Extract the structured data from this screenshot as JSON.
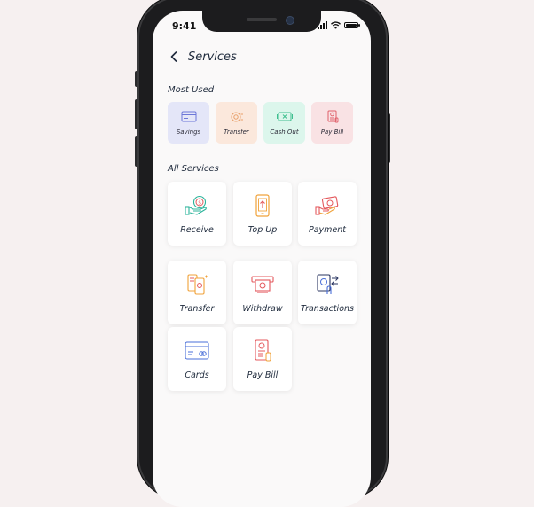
{
  "status_bar": {
    "time": "9:41"
  },
  "header": {
    "title": "Services"
  },
  "sections": {
    "most_used": "Most Used",
    "all_services": "All Services"
  },
  "most_used": [
    {
      "label": "Savings",
      "icon": "savings-card-icon",
      "bg": "#e4e6f8",
      "color": "#6c77d8"
    },
    {
      "label": "Transfer",
      "icon": "transfer-coin-icon",
      "bg": "#fbe8dc",
      "color": "#e8a06a"
    },
    {
      "label": "Cash Out",
      "icon": "cash-out-icon",
      "bg": "#dcf6ec",
      "color": "#3fbf8f"
    },
    {
      "label": "Pay Bill",
      "icon": "pay-bill-icon",
      "bg": "#f9e2e4",
      "color": "#e0606a"
    }
  ],
  "services": [
    {
      "label": "Receive",
      "icon": "receive-hand-coin-icon"
    },
    {
      "label": "Top Up",
      "icon": "top-up-phone-icon"
    },
    {
      "label": "Payment",
      "icon": "payment-card-icon"
    },
    {
      "label": "Transfer",
      "icon": "transfer-phone-icon"
    },
    {
      "label": "Withdraw",
      "icon": "withdraw-cash-icon"
    },
    {
      "label": "Transactions",
      "icon": "transactions-icon"
    },
    {
      "label": "Cards",
      "icon": "cards-icon"
    },
    {
      "label": "Pay Bill",
      "icon": "pay-bill-icon"
    }
  ],
  "colors": {
    "teal": "#2bb39a",
    "orange": "#f0a23a",
    "red": "#e4585c",
    "blue": "#4a6fd8",
    "navy": "#2a3560"
  }
}
